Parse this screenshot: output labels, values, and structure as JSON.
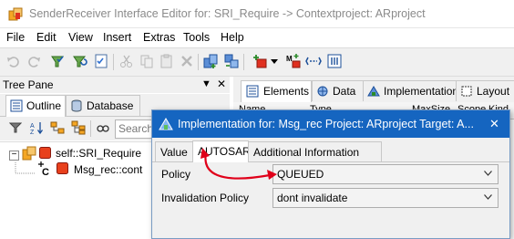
{
  "window": {
    "title": "SenderReceiver Interface Editor for: SRI_Require -> Contextproject: ARproject"
  },
  "menubar": {
    "items": [
      "File",
      "Edit",
      "View",
      "Insert",
      "Extras",
      "Tools",
      "Help"
    ]
  },
  "toolbar": {
    "icons": [
      "undo-icon",
      "redo-icon",
      "check-icon",
      "refresh-icon",
      "checklist-icon",
      "cut-icon",
      "copy-icon",
      "paste-icon",
      "delete-icon",
      "add-element-icon",
      "move-element-icon",
      "add-port-icon",
      "dropdown-arrow-icon",
      "add-mapping-icon",
      "link-icon",
      "grid-icon"
    ]
  },
  "tree_pane": {
    "title": "Tree Pane",
    "pin_glyph": "▼",
    "close_glyph": "✕",
    "tabs": [
      {
        "label": "Outline",
        "active": true
      },
      {
        "label": "Database",
        "active": false
      }
    ],
    "search_placeholder": "Search",
    "tree": [
      {
        "expander": "−",
        "label": "self::SRI_Require"
      },
      {
        "label": "Msg_rec::cont"
      }
    ]
  },
  "right_pane": {
    "tabs": [
      {
        "label": "Elements",
        "active": true
      },
      {
        "label": "Data",
        "active": false
      },
      {
        "label": "Implementation",
        "active": false
      },
      {
        "label": "Layout",
        "active": false
      }
    ],
    "columns": [
      "Name",
      "Type",
      "MaxSize",
      "Scope",
      "Kind"
    ]
  },
  "dialog": {
    "title": "Implementation for: Msg_rec   Project: ARproject   Target: A...",
    "close_glyph": "✕",
    "tabs": [
      {
        "label": "Value",
        "active": false
      },
      {
        "label": "AUTOSAR",
        "active": true
      },
      {
        "label": "Additional Information",
        "active": false
      }
    ],
    "fields": [
      {
        "label": "Policy",
        "value": "QUEUED"
      },
      {
        "label": "Invalidation Policy",
        "value": "dont invalidate"
      }
    ]
  },
  "colors": {
    "dialog_title_bg": "#1565c0",
    "annotation_arrow": "#e0001a"
  }
}
